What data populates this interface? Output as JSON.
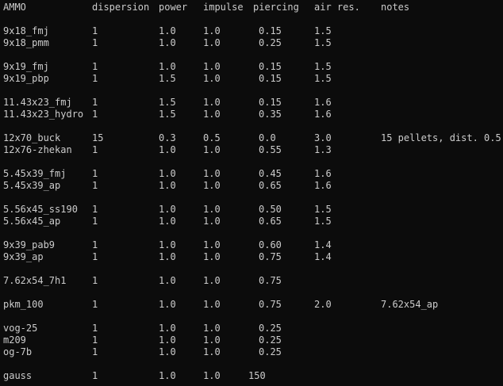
{
  "header": [
    "AMMO",
    "dispersion",
    "power",
    "impulse",
    "piercing",
    "air res.",
    "notes"
  ],
  "rows": [
    [
      "9x18_fmj",
      "1",
      "1.0",
      "1.0",
      "0.15",
      "1.5",
      ""
    ],
    [
      "9x18_pmm",
      "1",
      "1.0",
      "1.0",
      "0.25",
      "1.5",
      ""
    ],
    [
      "9x19_fmj",
      "1",
      "1.0",
      "1.0",
      "0.15",
      "1.5",
      ""
    ],
    [
      "9x19_pbp",
      "1",
      "1.5",
      "1.0",
      "0.15",
      "1.5",
      ""
    ],
    [
      "11.43x23_fmj",
      "1",
      "1.5",
      "1.0",
      "0.15",
      "1.6",
      ""
    ],
    [
      "11.43x23_hydro",
      "1",
      "1.5",
      "1.0",
      "0.35",
      "1.6",
      ""
    ],
    [
      "12x70_buck",
      "15",
      "0.3",
      "0.5",
      "0.0",
      "3.0",
      "15 pellets, dist. 0.5"
    ],
    [
      "12x76-zhekan",
      "1",
      "1.0",
      "1.0",
      "0.55",
      "1.3",
      ""
    ],
    [
      "5.45x39_fmj",
      "1",
      "1.0",
      "1.0",
      "0.45",
      "1.6",
      ""
    ],
    [
      "5.45x39_ap",
      "1",
      "1.0",
      "1.0",
      "0.65",
      "1.6",
      ""
    ],
    [
      "5.56x45_ss190",
      "1",
      "1.0",
      "1.0",
      "0.50",
      "1.5",
      ""
    ],
    [
      "5.56x45_ap",
      "1",
      "1.0",
      "1.0",
      "0.65",
      "1.5",
      ""
    ],
    [
      "9x39_pab9",
      "1",
      "1.0",
      "1.0",
      "0.60",
      "1.4",
      ""
    ],
    [
      "9x39_ap",
      "1",
      "1.0",
      "1.0",
      "0.75",
      "1.4",
      ""
    ],
    [
      "7.62x54_7h1",
      "1",
      "1.0",
      "1.0",
      "0.75",
      "",
      ""
    ],
    [
      "pkm_100",
      "1",
      "1.0",
      "1.0",
      "0.75",
      "2.0",
      "7.62x54_ap"
    ],
    [
      "vog-25",
      "1",
      "1.0",
      "1.0",
      "0.25",
      "",
      ""
    ],
    [
      "m209",
      "1",
      "1.0",
      "1.0",
      "0.25",
      "",
      ""
    ],
    [
      "og-7b",
      "1",
      "1.0",
      "1.0",
      "0.25",
      "",
      ""
    ],
    [
      "gauss",
      "1",
      "1.0",
      "1.0",
      "150",
      "",
      ""
    ]
  ]
}
